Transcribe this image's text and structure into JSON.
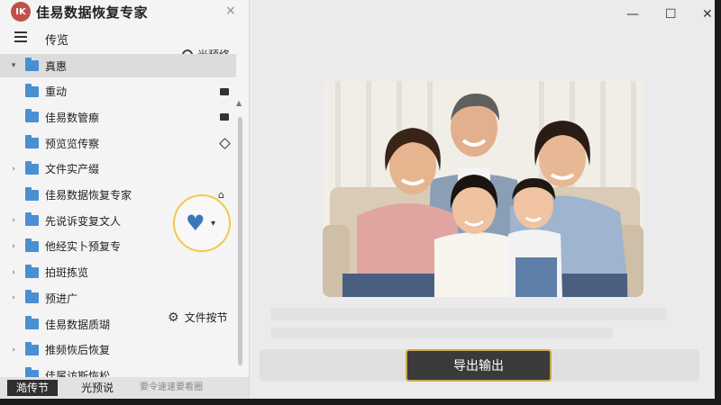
{
  "app": {
    "title": "佳易数据恢复专家",
    "logo_text": "IK",
    "close_icon": "×"
  },
  "toolbar": {
    "label": "传览"
  },
  "preview_toggle": {
    "label": "光预络"
  },
  "tree": [
    {
      "label": "真惠",
      "expandable": true,
      "selected": true
    },
    {
      "label": "重动",
      "expandable": false,
      "icon": "box"
    },
    {
      "label": "佳易数管瘵",
      "expandable": false,
      "icon": "box"
    },
    {
      "label": "预览览传察",
      "expandable": false,
      "icon": "diamond"
    },
    {
      "label": "文件实产缀",
      "expandable": true
    },
    {
      "label": "佳易数据恢复专家",
      "expandable": false,
      "icon": "pin"
    },
    {
      "label": "先说诉变复文人",
      "expandable": true
    },
    {
      "label": "他经实卜预复专",
      "expandable": true
    },
    {
      "label": "拍斑拣览",
      "expandable": true
    },
    {
      "label": "预进广",
      "expandable": true
    },
    {
      "label": "佳易数据质瑚",
      "expandable": false
    },
    {
      "label": "推频恢后恢复",
      "expandable": true
    },
    {
      "label": "佳属访斯恢松",
      "expandable": false
    }
  ],
  "file_settings": {
    "label": "文件按节"
  },
  "statusbar": {
    "tab1": "澔传节",
    "tab2": "光预说",
    "text3": "要令速速要看圈"
  },
  "window_controls": {
    "minimize": "—",
    "maximize": "☐",
    "close": "✕"
  },
  "export_button": {
    "label": "导出输出"
  }
}
